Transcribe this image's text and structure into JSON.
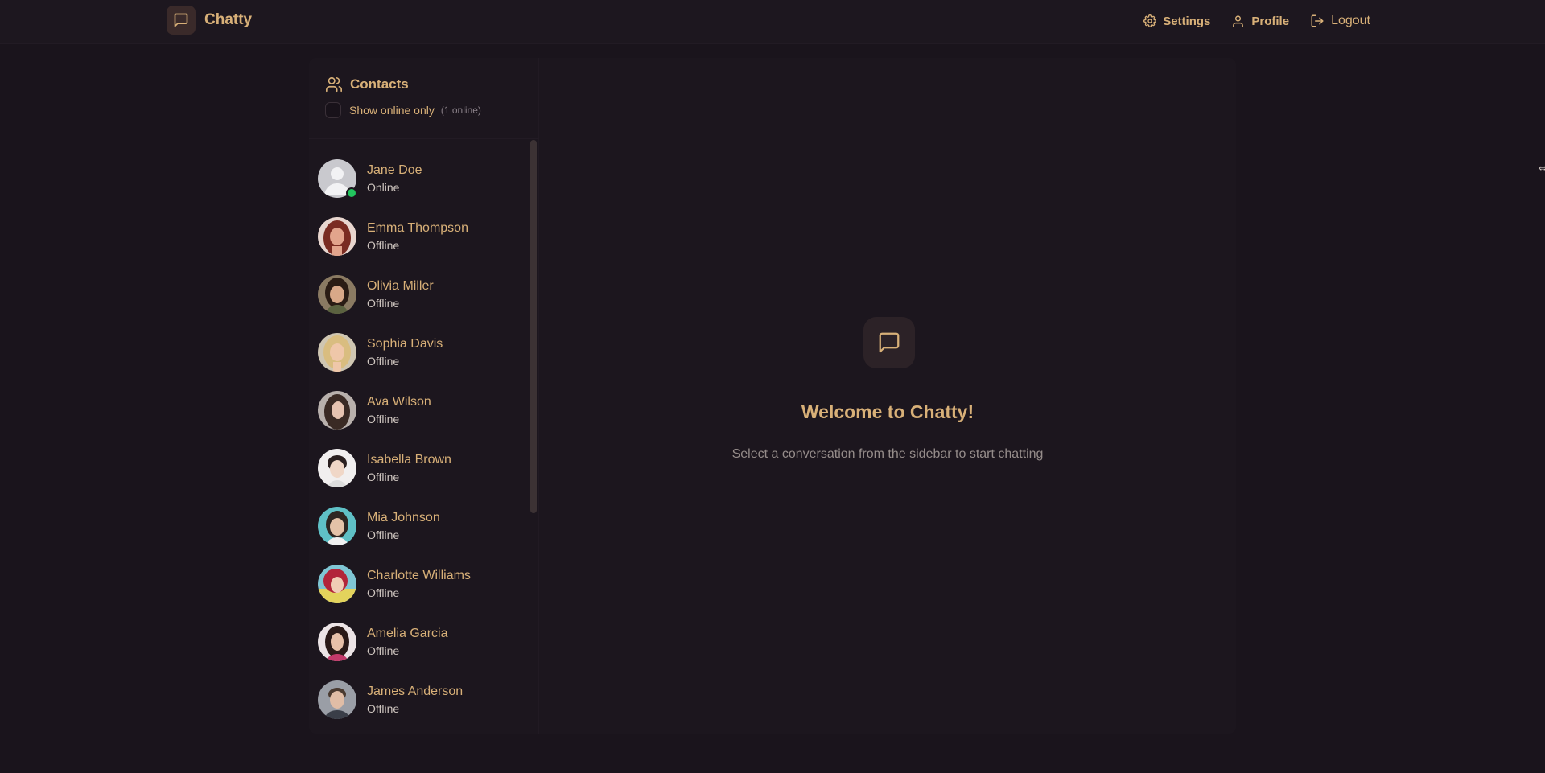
{
  "app": {
    "name": "Chatty"
  },
  "nav": {
    "settings": "Settings",
    "profile": "Profile",
    "logout": "Logout"
  },
  "sidebar": {
    "title": "Contacts",
    "filter_label": "Show online only",
    "online_count": "(1 online)",
    "contacts": [
      {
        "name": "Jane Doe",
        "status": "Online"
      },
      {
        "name": "Emma Thompson",
        "status": "Offline"
      },
      {
        "name": "Olivia Miller",
        "status": "Offline"
      },
      {
        "name": "Sophia Davis",
        "status": "Offline"
      },
      {
        "name": "Ava Wilson",
        "status": "Offline"
      },
      {
        "name": "Isabella Brown",
        "status": "Offline"
      },
      {
        "name": "Mia Johnson",
        "status": "Offline"
      },
      {
        "name": "Charlotte Williams",
        "status": "Offline"
      },
      {
        "name": "Amelia Garcia",
        "status": "Offline"
      },
      {
        "name": "James Anderson",
        "status": "Offline"
      }
    ]
  },
  "welcome": {
    "title": "Welcome to Chatty!",
    "subtitle": "Select a conversation from the sidebar to start chatting"
  },
  "colors": {
    "background": "#1a141c",
    "accent": "#d8b078",
    "online": "#22c55e"
  }
}
